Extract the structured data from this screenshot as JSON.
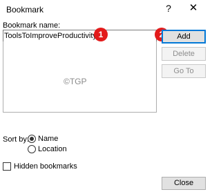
{
  "window": {
    "title": "Bookmark",
    "help_glyph": "?",
    "close_glyph": "✕"
  },
  "bookmark_name": {
    "label": "Bookmark name:",
    "value": "ToolsToImproveProductivity"
  },
  "buttons": {
    "add": "Add",
    "delete": "Delete",
    "go_to": "Go To",
    "close": "Close"
  },
  "watermark": "©TGP",
  "sort_by": {
    "label": "Sort by:",
    "options": [
      "Name",
      "Location"
    ],
    "selected": "Name"
  },
  "hidden_bookmarks": {
    "label": "Hidden bookmarks",
    "checked": false
  },
  "markers": [
    "1",
    "2"
  ],
  "colors": {
    "marker": "#e31b1b",
    "focus_border": "#0078d7"
  }
}
